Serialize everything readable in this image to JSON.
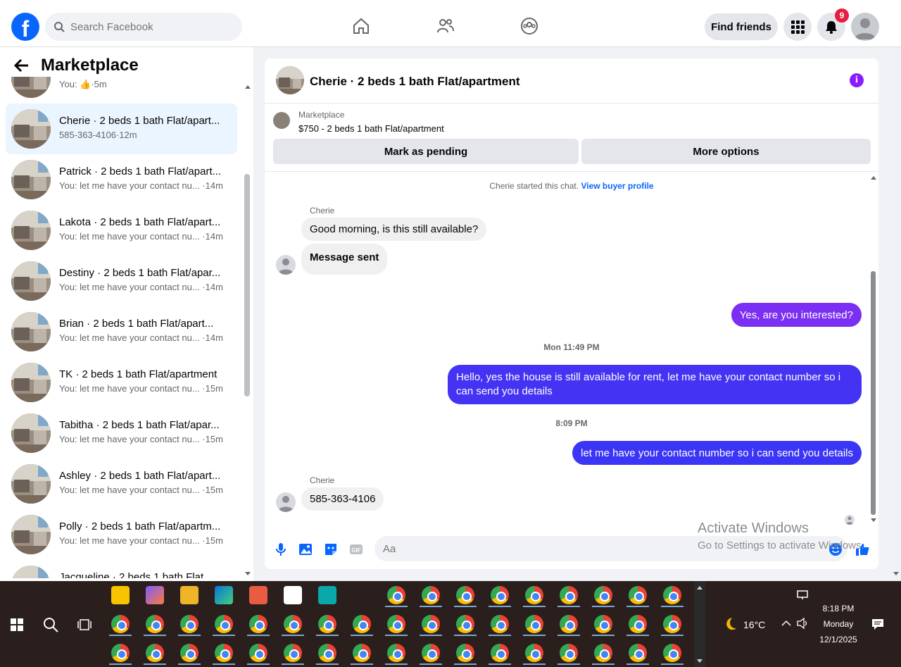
{
  "header": {
    "search_placeholder": "Search Facebook",
    "find_friends_label": "Find friends",
    "notification_count": "9"
  },
  "sidebar": {
    "title": "Marketplace",
    "conversations": [
      {
        "title": "",
        "subtitle": "You: 👍·5m"
      },
      {
        "title": "Cherie · 2 beds 1 bath Flat/apart...",
        "subtitle": "585-363-4106·12m",
        "active": true
      },
      {
        "title": "Patrick · 2 beds 1 bath Flat/apart...",
        "subtitle": "You: let me have your contact nu... ·14m"
      },
      {
        "title": "Lakota · 2 beds 1 bath Flat/apart...",
        "subtitle": "You: let me have your contact nu... ·14m"
      },
      {
        "title": "Destiny · 2 beds 1 bath Flat/apar...",
        "subtitle": "You: let me have your contact nu... ·14m"
      },
      {
        "title": "Brian · 2 beds 1 bath Flat/apart...",
        "subtitle": "You: let me have your contact nu... ·14m"
      },
      {
        "title": "TK · 2 beds 1 bath Flat/apartment",
        "subtitle": "You: let me have your contact nu... ·15m"
      },
      {
        "title": "Tabitha · 2 beds 1 bath Flat/apar...",
        "subtitle": "You: let me have your contact nu... ·15m"
      },
      {
        "title": "Ashley · 2 beds 1 bath Flat/apart...",
        "subtitle": "You: let me have your contact nu... ·15m"
      },
      {
        "title": "Polly · 2 beds 1 bath Flat/apartm...",
        "subtitle": "You: let me have your contact nu... ·15m"
      },
      {
        "title": "Jacqueline · 2 beds 1 bath Flat...",
        "subtitle": ""
      }
    ]
  },
  "chat": {
    "title": "Cherie · 2 beds 1 bath Flat/apartment",
    "listing": {
      "label": "Marketplace",
      "price_title": "$750 - 2 beds 1 bath Flat/apartment",
      "mark_pending": "Mark as pending",
      "more_options": "More options"
    },
    "started_text": "Cherie started this chat.",
    "view_profile": "View buyer profile",
    "messages": [
      {
        "sender": "Cherie",
        "text": "Good morning, is this still available?"
      },
      {
        "text": "Message sent"
      },
      {
        "text": "Yes, are you interested?"
      },
      {
        "timestamp": "Mon 11:49 PM"
      },
      {
        "text": "Hello, yes the house is still available for rent, let me have your contact number so i can send you details"
      },
      {
        "timestamp": "8:09 PM"
      },
      {
        "text": "let me have your contact number so i can send you details"
      },
      {
        "sender": "Cherie",
        "text": "585-363-4106"
      }
    ],
    "composer_placeholder": "Aa",
    "colors": {
      "outgoing_purple": "#7b2ff2",
      "outgoing_blue": "#3b35f5",
      "accent": "#0866ff"
    }
  },
  "watermark": {
    "line1": "Activate Windows",
    "line2": "Go to Settings to activate Windows."
  },
  "taskbar": {
    "weather": "16°C",
    "time": "8:18 PM",
    "day": "Monday",
    "date": "12/1/2025"
  }
}
